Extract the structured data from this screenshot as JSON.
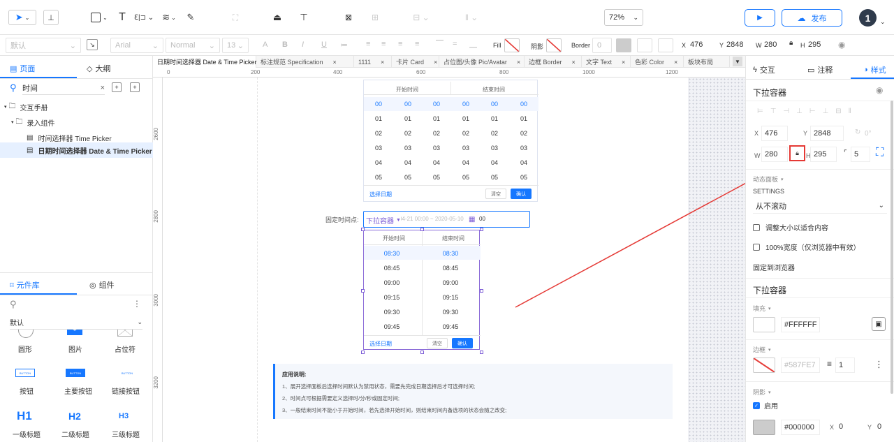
{
  "toolbar": {
    "zoom": "72%",
    "publish": "发布",
    "user_badge": "1"
  },
  "format_bar": {
    "font_style": "默认",
    "font_family": "Arial",
    "font_weight": "Normal",
    "font_size": "13",
    "fill_label": "Fill",
    "shadow_label": "阴影",
    "border_label": "Border",
    "border_value": "0",
    "x_label": "X",
    "x_value": "476",
    "y_label": "Y",
    "y_value": "2848",
    "w_label": "W",
    "w_value": "280",
    "h_label": "H",
    "h_value": "295"
  },
  "left_panel": {
    "tab_pages": "页面",
    "tab_outline": "大纲",
    "search_value": "时间",
    "tree": [
      {
        "label": "交互手册"
      },
      {
        "label": "录入组件"
      },
      {
        "label": "时间选择器 Time Picker"
      },
      {
        "label": "日期时间选择器 Date & Time Picker"
      }
    ],
    "lib_tab": "元件库",
    "comp_tab": "组件",
    "lib_select": "默认",
    "widgets": [
      {
        "label": "圆形"
      },
      {
        "label": "图片"
      },
      {
        "label": "占位符"
      },
      {
        "label": "按钮",
        "thumb": "BUTTON"
      },
      {
        "label": "主要按钮",
        "thumb": "BUTTON"
      },
      {
        "label": "链接按钮",
        "thumb": "BUTTON"
      },
      {
        "label": "一级标题",
        "thumb": "H1"
      },
      {
        "label": "二级标题",
        "thumb": "H2"
      },
      {
        "label": "三级标题",
        "thumb": "H3"
      }
    ]
  },
  "tabs": [
    "日期时间选择器 Date & Time Picker",
    "标注规范 Specification",
    "1111",
    "卡片 Card",
    "占位图/头像 Pic/Avatar",
    "边框 Border",
    "文字 Text",
    "色彩 Color",
    "板块布局"
  ],
  "ruler": {
    "h": [
      "0",
      "200",
      "400",
      "600",
      "800",
      "1000",
      "1200"
    ],
    "v": [
      "2600",
      "2800",
      "3000",
      "3200"
    ]
  },
  "canvas": {
    "picker1": {
      "start": "开始时间",
      "end": "结束时间",
      "rows": [
        [
          "00",
          "00",
          "00",
          "00",
          "00",
          "00"
        ],
        [
          "01",
          "01",
          "01",
          "01",
          "01",
          "01"
        ],
        [
          "02",
          "02",
          "02",
          "02",
          "02",
          "02"
        ],
        [
          "03",
          "03",
          "03",
          "03",
          "03",
          "03"
        ],
        [
          "04",
          "04",
          "04",
          "04",
          "04",
          "04"
        ],
        [
          "05",
          "05",
          "05",
          "05",
          "05",
          "05"
        ]
      ],
      "select_date": "选择日期",
      "clear": "清空",
      "ok": "确认"
    },
    "fixed_label": "固定时间点:",
    "input_text": "04-21 00:00 ~ 2020-05-10",
    "input_suffix": "00",
    "dropdown_tag": "下拉容器",
    "picker2": {
      "start": "开始时间",
      "end": "结束时间",
      "rows": [
        [
          "08:30",
          "08:30"
        ],
        [
          "08:45",
          "08:45"
        ],
        [
          "09:00",
          "09:00"
        ],
        [
          "09:15",
          "09:15"
        ],
        [
          "09:30",
          "09:30"
        ],
        [
          "09:45",
          "09:45"
        ]
      ],
      "select_date": "选择日期",
      "clear": "清空",
      "ok": "确认"
    },
    "notes_title": "应用说明:",
    "notes": [
      "1、展开选择面板后选择时间默认为禁用状态，需要先完成日期选择后才可选择时间;",
      "2、时间点可根据需要定义选择时/分/秒或固定时间;",
      "3、一般结束时间不能小于开始时间，若先选择开始时间，则结束时间内备选项的状态会随之改变;"
    ]
  },
  "right_panel": {
    "tab_interact": "交互",
    "tab_notes": "注释",
    "tab_style": "样式",
    "title": "下拉容器",
    "x": "476",
    "y": "2848",
    "rot": "0°",
    "w": "280",
    "h": "295",
    "radius": "5",
    "dyn_label": "动态面板",
    "settings": "SETTINGS",
    "scroll_mode": "从不滚动",
    "opt_fit": "调整大小以适合内容",
    "opt_full": "100%宽度（仅浏览器中有效）",
    "fix_browser": "固定到浏览器",
    "section_title": "下拉容器",
    "fill_label": "填充",
    "fill_hex": "#FFFFFF",
    "border_label": "边框",
    "border_hex": "#587FE7",
    "border_width": "1",
    "shadow_label": "阴影",
    "shadow_enable": "启用",
    "shadow_hex": "#000000",
    "shadow_x_label": "X",
    "shadow_x": "0",
    "shadow_y_label": "Y",
    "shadow_y": "0"
  },
  "colors": {
    "accent": "#1677ff",
    "purple": "#8b5cf6",
    "selection": "#7c5cd6",
    "red": "#e53935",
    "highlight": "#e6f0ff"
  }
}
